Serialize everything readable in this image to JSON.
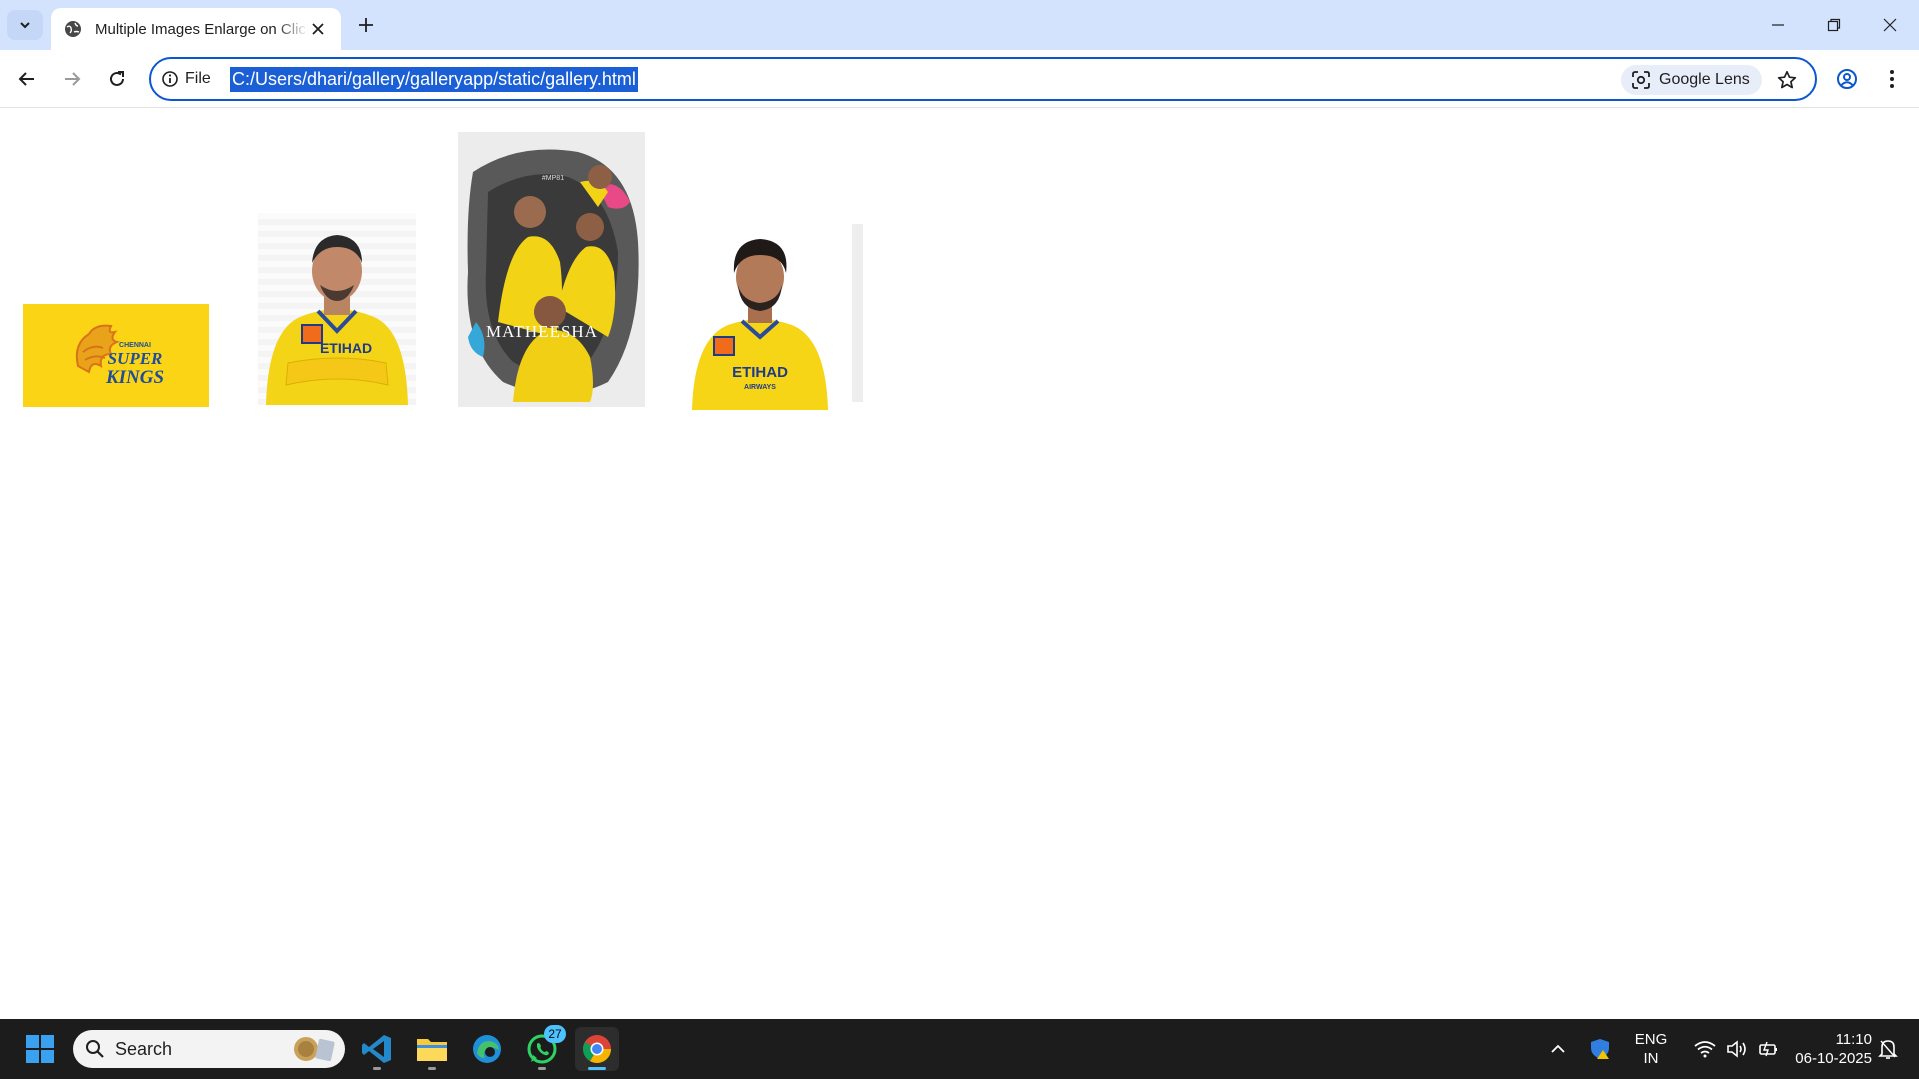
{
  "browser": {
    "tab": {
      "title": "Multiple Images Enlarge on Click"
    },
    "address": {
      "scheme_label": "File",
      "url": "C:/Users/dhari/gallery/galleryapp/static/gallery.html"
    },
    "lens_label": "Google Lens"
  },
  "gallery": {
    "images": [
      {
        "subject": "Chennai Super Kings logo",
        "lettering": [
          "CHENNAI",
          "SUPER",
          "KINGS"
        ],
        "color": "#fbd415"
      },
      {
        "subject": "Player portrait in yellow jersey, arms crossed",
        "lettering": [
          "ETIHAD"
        ]
      },
      {
        "subject": "Team poster",
        "lettering": [
          "MATHEESHA",
          "#MP81"
        ]
      },
      {
        "subject": "Player portrait in yellow jersey",
        "lettering": [
          "ETIHAD",
          "AIRWAYS"
        ]
      }
    ]
  },
  "taskbar": {
    "search_placeholder": "Search",
    "whatsapp_badge": "27",
    "lang_line1": "ENG",
    "lang_line2": "IN",
    "time": "11:10",
    "date": "06-10-2025"
  },
  "colors": {
    "accent": "#0b57d0",
    "tabstrip": "#d3e3fd",
    "taskbar": "#1c1c1c",
    "csk_yellow": "#fbd415"
  }
}
